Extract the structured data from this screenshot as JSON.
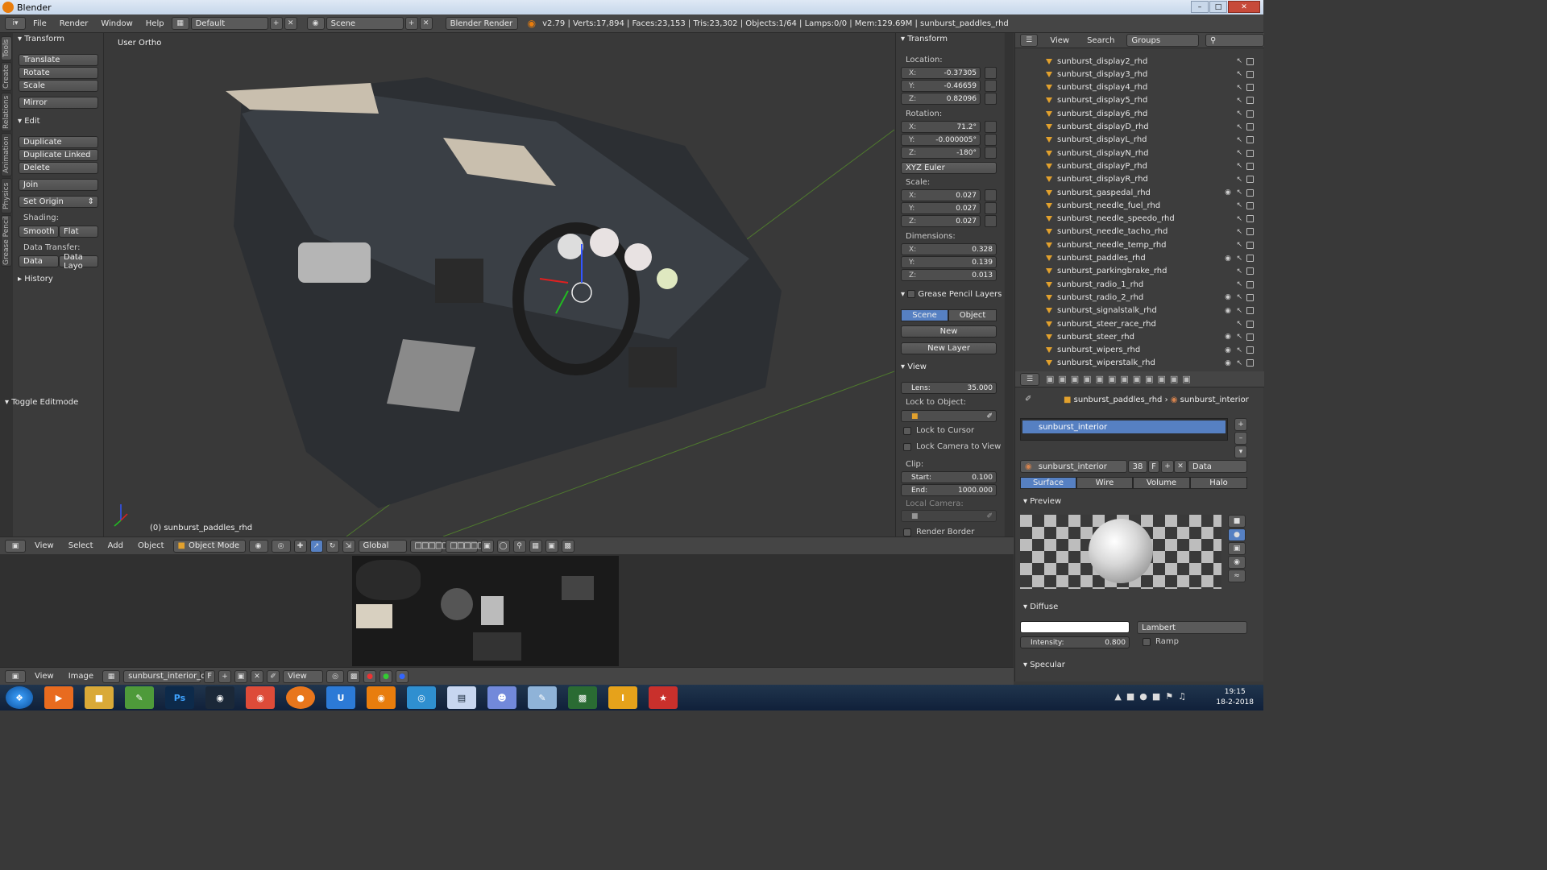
{
  "window": {
    "title": "Blender"
  },
  "infobar": {
    "menus": [
      "File",
      "Render",
      "Window",
      "Help"
    ],
    "layout": "Default",
    "scene": "Scene",
    "engine": "Blender Render",
    "stats": "v2.79 | Verts:17,894 | Faces:23,153 | Tris:23,302 | Objects:1/64 | Lamps:0/0 | Mem:129.69M | sunburst_paddles_rhd"
  },
  "vtabs": [
    "Tools",
    "Create",
    "Relations",
    "Animation",
    "Physics",
    "Grease Pencil"
  ],
  "toolshelf": {
    "transform_hdr": "Transform",
    "translate": "Translate",
    "rotate": "Rotate",
    "scale": "Scale",
    "mirror": "Mirror",
    "edit_hdr": "Edit",
    "duplicate": "Duplicate",
    "duplicate_linked": "Duplicate Linked",
    "delete": "Delete",
    "join": "Join",
    "set_origin": "Set Origin",
    "shading_lbl": "Shading:",
    "smooth": "Smooth",
    "flat": "Flat",
    "data_transfer_lbl": "Data Transfer:",
    "data": "Data",
    "data_layo": "Data Layo",
    "history_hdr": "History",
    "toggle_editmode": "Toggle Editmode"
  },
  "viewport": {
    "label": "User Ortho",
    "object": "(0) sunburst_paddles_rhd"
  },
  "npanel": {
    "transform_hdr": "Transform",
    "location_lbl": "Location:",
    "loc": {
      "x": "-0.37305",
      "y": "-0.46659",
      "z": "0.82096"
    },
    "rotation_lbl": "Rotation:",
    "rot": {
      "x": "71.2°",
      "y": "-0.000005°",
      "z": "-180°"
    },
    "rot_mode": "XYZ Euler",
    "scale_lbl": "Scale:",
    "scl": {
      "x": "0.027",
      "y": "0.027",
      "z": "0.027"
    },
    "dimensions_lbl": "Dimensions:",
    "dim": {
      "x": "0.328",
      "y": "0.139",
      "z": "0.013"
    },
    "gp_hdr": "Grease Pencil Layers",
    "gp_scene": "Scene",
    "gp_object": "Object",
    "gp_new": "New",
    "gp_new_layer": "New Layer",
    "view_hdr": "View",
    "lens_lbl": "Lens:",
    "lens": "35.000",
    "lock_obj_lbl": "Lock to Object:",
    "lock_cursor": "Lock to Cursor",
    "lock_camera": "Lock Camera to View",
    "clip_lbl": "Clip:",
    "clip_start_lbl": "Start:",
    "clip_start": "0.100",
    "clip_end_lbl": "End:",
    "clip_end": "1000.000",
    "local_camera_lbl": "Local Camera:",
    "render_border": "Render Border"
  },
  "outliner": {
    "view": "View",
    "search": "Search",
    "display": "Groups",
    "items": [
      "sunburst_display2_rhd",
      "sunburst_display3_rhd",
      "sunburst_display4_rhd",
      "sunburst_display5_rhd",
      "sunburst_display6_rhd",
      "sunburst_displayD_rhd",
      "sunburst_displayL_rhd",
      "sunburst_displayN_rhd",
      "sunburst_displayP_rhd",
      "sunburst_displayR_rhd",
      "sunburst_gaspedal_rhd",
      "sunburst_needle_fuel_rhd",
      "sunburst_needle_speedo_rhd",
      "sunburst_needle_tacho_rhd",
      "sunburst_needle_temp_rhd",
      "sunburst_paddles_rhd",
      "sunburst_parkingbrake_rhd",
      "sunburst_radio_1_rhd",
      "sunburst_radio_2_rhd",
      "sunburst_signalstalk_rhd",
      "sunburst_steer_race_rhd",
      "sunburst_steer_rhd",
      "sunburst_wipers_rhd",
      "sunburst_wiperstalk_rhd"
    ]
  },
  "props": {
    "crumb_obj": "sunburst_paddles_rhd",
    "crumb_mat": "sunburst_interior",
    "slot": "sunburst_interior",
    "mat_name": "sunburst_interior",
    "users": "38",
    "fake": "F",
    "link": "Data",
    "tabs": [
      "Surface",
      "Wire",
      "Volume",
      "Halo"
    ],
    "preview_hdr": "Preview",
    "diffuse_hdr": "Diffuse",
    "shader": "Lambert",
    "intensity_lbl": "Intensity:",
    "intensity": "0.800",
    "ramp": "Ramp",
    "specular_hdr": "Specular"
  },
  "vpheader": {
    "view": "View",
    "select": "Select",
    "add": "Add",
    "object": "Object",
    "mode": "Object Mode",
    "orientation": "Global"
  },
  "imgheader": {
    "view": "View",
    "image": "Image",
    "image_name": "sunburst_interior_d...",
    "fake": "F",
    "view2": "View"
  },
  "taskbar": {
    "time": "19:15",
    "date": "18-2-2018"
  }
}
